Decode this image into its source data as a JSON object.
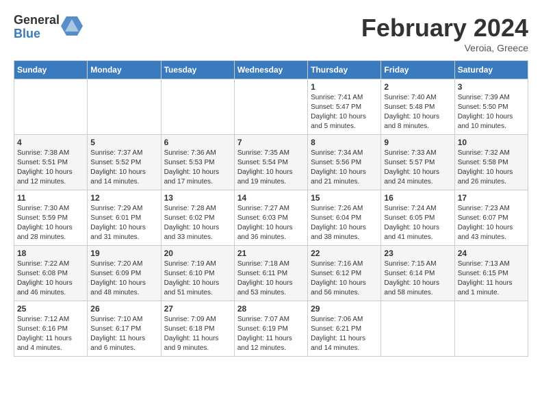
{
  "header": {
    "logo_general": "General",
    "logo_blue": "Blue",
    "month_title": "February 2024",
    "subtitle": "Veroia, Greece"
  },
  "calendar": {
    "days_of_week": [
      "Sunday",
      "Monday",
      "Tuesday",
      "Wednesday",
      "Thursday",
      "Friday",
      "Saturday"
    ],
    "weeks": [
      [
        {
          "day": "",
          "info": ""
        },
        {
          "day": "",
          "info": ""
        },
        {
          "day": "",
          "info": ""
        },
        {
          "day": "",
          "info": ""
        },
        {
          "day": "1",
          "info": "Sunrise: 7:41 AM\nSunset: 5:47 PM\nDaylight: 10 hours\nand 5 minutes."
        },
        {
          "day": "2",
          "info": "Sunrise: 7:40 AM\nSunset: 5:48 PM\nDaylight: 10 hours\nand 8 minutes."
        },
        {
          "day": "3",
          "info": "Sunrise: 7:39 AM\nSunset: 5:50 PM\nDaylight: 10 hours\nand 10 minutes."
        }
      ],
      [
        {
          "day": "4",
          "info": "Sunrise: 7:38 AM\nSunset: 5:51 PM\nDaylight: 10 hours\nand 12 minutes."
        },
        {
          "day": "5",
          "info": "Sunrise: 7:37 AM\nSunset: 5:52 PM\nDaylight: 10 hours\nand 14 minutes."
        },
        {
          "day": "6",
          "info": "Sunrise: 7:36 AM\nSunset: 5:53 PM\nDaylight: 10 hours\nand 17 minutes."
        },
        {
          "day": "7",
          "info": "Sunrise: 7:35 AM\nSunset: 5:54 PM\nDaylight: 10 hours\nand 19 minutes."
        },
        {
          "day": "8",
          "info": "Sunrise: 7:34 AM\nSunset: 5:56 PM\nDaylight: 10 hours\nand 21 minutes."
        },
        {
          "day": "9",
          "info": "Sunrise: 7:33 AM\nSunset: 5:57 PM\nDaylight: 10 hours\nand 24 minutes."
        },
        {
          "day": "10",
          "info": "Sunrise: 7:32 AM\nSunset: 5:58 PM\nDaylight: 10 hours\nand 26 minutes."
        }
      ],
      [
        {
          "day": "11",
          "info": "Sunrise: 7:30 AM\nSunset: 5:59 PM\nDaylight: 10 hours\nand 28 minutes."
        },
        {
          "day": "12",
          "info": "Sunrise: 7:29 AM\nSunset: 6:01 PM\nDaylight: 10 hours\nand 31 minutes."
        },
        {
          "day": "13",
          "info": "Sunrise: 7:28 AM\nSunset: 6:02 PM\nDaylight: 10 hours\nand 33 minutes."
        },
        {
          "day": "14",
          "info": "Sunrise: 7:27 AM\nSunset: 6:03 PM\nDaylight: 10 hours\nand 36 minutes."
        },
        {
          "day": "15",
          "info": "Sunrise: 7:26 AM\nSunset: 6:04 PM\nDaylight: 10 hours\nand 38 minutes."
        },
        {
          "day": "16",
          "info": "Sunrise: 7:24 AM\nSunset: 6:05 PM\nDaylight: 10 hours\nand 41 minutes."
        },
        {
          "day": "17",
          "info": "Sunrise: 7:23 AM\nSunset: 6:07 PM\nDaylight: 10 hours\nand 43 minutes."
        }
      ],
      [
        {
          "day": "18",
          "info": "Sunrise: 7:22 AM\nSunset: 6:08 PM\nDaylight: 10 hours\nand 46 minutes."
        },
        {
          "day": "19",
          "info": "Sunrise: 7:20 AM\nSunset: 6:09 PM\nDaylight: 10 hours\nand 48 minutes."
        },
        {
          "day": "20",
          "info": "Sunrise: 7:19 AM\nSunset: 6:10 PM\nDaylight: 10 hours\nand 51 minutes."
        },
        {
          "day": "21",
          "info": "Sunrise: 7:18 AM\nSunset: 6:11 PM\nDaylight: 10 hours\nand 53 minutes."
        },
        {
          "day": "22",
          "info": "Sunrise: 7:16 AM\nSunset: 6:12 PM\nDaylight: 10 hours\nand 56 minutes."
        },
        {
          "day": "23",
          "info": "Sunrise: 7:15 AM\nSunset: 6:14 PM\nDaylight: 10 hours\nand 58 minutes."
        },
        {
          "day": "24",
          "info": "Sunrise: 7:13 AM\nSunset: 6:15 PM\nDaylight: 11 hours\nand 1 minute."
        }
      ],
      [
        {
          "day": "25",
          "info": "Sunrise: 7:12 AM\nSunset: 6:16 PM\nDaylight: 11 hours\nand 4 minutes."
        },
        {
          "day": "26",
          "info": "Sunrise: 7:10 AM\nSunset: 6:17 PM\nDaylight: 11 hours\nand 6 minutes."
        },
        {
          "day": "27",
          "info": "Sunrise: 7:09 AM\nSunset: 6:18 PM\nDaylight: 11 hours\nand 9 minutes."
        },
        {
          "day": "28",
          "info": "Sunrise: 7:07 AM\nSunset: 6:19 PM\nDaylight: 11 hours\nand 12 minutes."
        },
        {
          "day": "29",
          "info": "Sunrise: 7:06 AM\nSunset: 6:21 PM\nDaylight: 11 hours\nand 14 minutes."
        },
        {
          "day": "",
          "info": ""
        },
        {
          "day": "",
          "info": ""
        }
      ]
    ]
  }
}
